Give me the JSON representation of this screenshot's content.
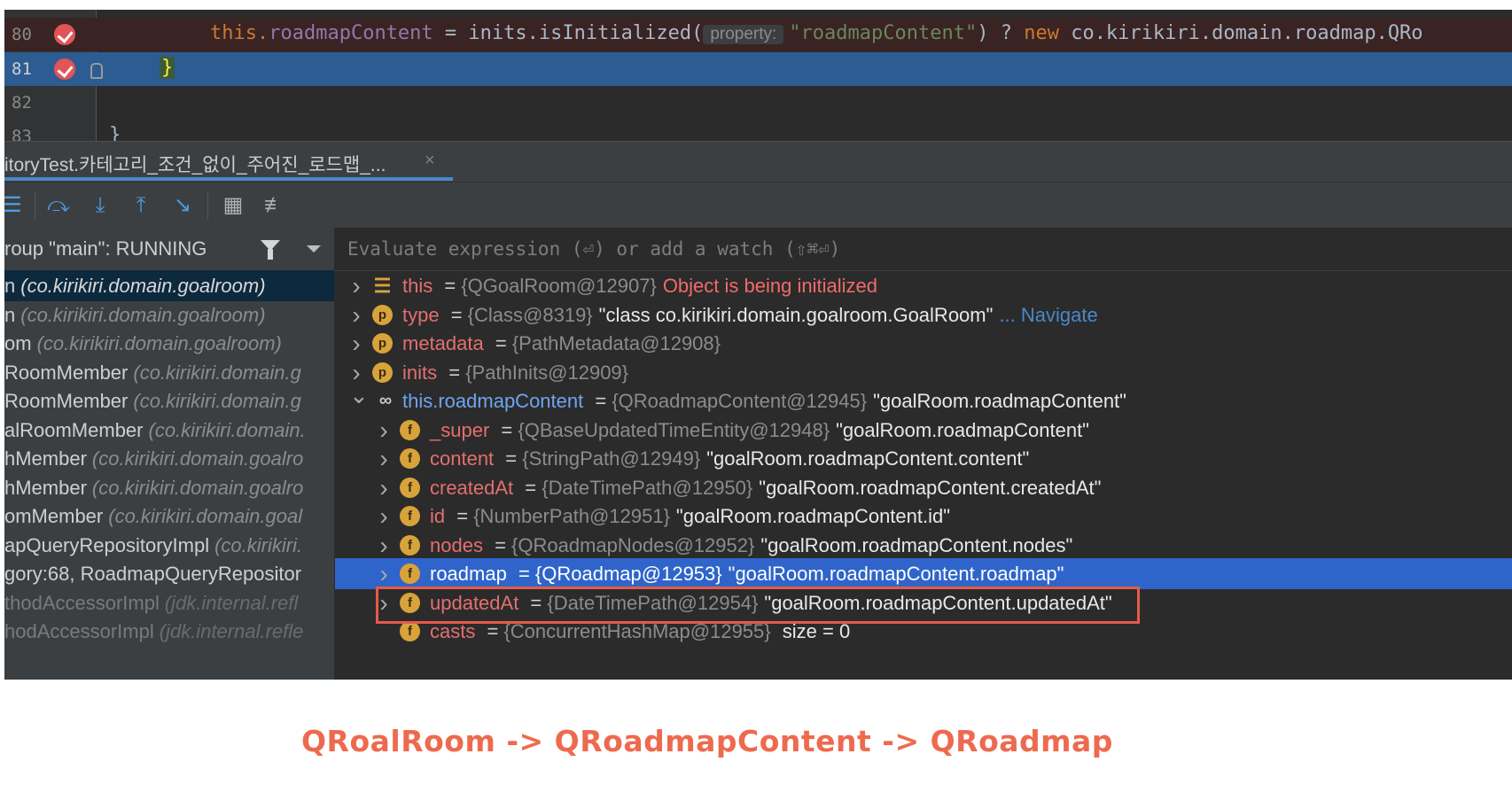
{
  "editor": {
    "lines": [
      {
        "number": "80",
        "code_prefix": "this.",
        "field": "roadmapContent",
        "mid": " = inits.isInitialized(",
        "hint": "property:",
        "string": "\"roadmapContent\"",
        "tail_a": ") ? ",
        "keyword_new": "new",
        "tail_b": " co.kirikiri.domain.roadmap.QRo"
      },
      {
        "number": "81",
        "text": "}"
      },
      {
        "number": "82",
        "text": ""
      },
      {
        "number": "83",
        "text": "}"
      }
    ]
  },
  "tab": {
    "label": "itoryTest.카테고리_조건_없이_주어진_로드맵_...",
    "close": "×"
  },
  "toolbar": {
    "icons": [
      "menu-icon",
      "show-execution-point-icon",
      "step-over-icon",
      "step-into-icon",
      "step-out-icon",
      "run-to-cursor-icon",
      "evaluate-table-icon",
      "trace-icon"
    ]
  },
  "frames": {
    "thread": "roup \"main\": RUNNING",
    "items": [
      {
        "name": "n",
        "pkg": "(co.kirikiri.domain.goalroom)",
        "selected": true,
        "lib": false
      },
      {
        "name": "n",
        "pkg": "(co.kirikiri.domain.goalroom)",
        "selected": false,
        "lib": false
      },
      {
        "name": "om",
        "pkg": "(co.kirikiri.domain.goalroom)",
        "selected": false,
        "lib": false
      },
      {
        "name": "RoomMember",
        "pkg": "(co.kirikiri.domain.g",
        "selected": false,
        "lib": false
      },
      {
        "name": "RoomMember",
        "pkg": "(co.kirikiri.domain.g",
        "selected": false,
        "lib": false
      },
      {
        "name": "alRoomMember",
        "pkg": "(co.kirikiri.domain.",
        "selected": false,
        "lib": false
      },
      {
        "name": "hMember",
        "pkg": "(co.kirikiri.domain.goalro",
        "selected": false,
        "lib": false
      },
      {
        "name": "hMember",
        "pkg": "(co.kirikiri.domain.goalro",
        "selected": false,
        "lib": false
      },
      {
        "name": "omMember",
        "pkg": "(co.kirikiri.domain.goal",
        "selected": false,
        "lib": false
      },
      {
        "name": "apQueryRepositoryImpl",
        "pkg": "(co.kirikiri.",
        "selected": false,
        "lib": false
      },
      {
        "name": "gory:68, RoadmapQueryRepositor",
        "pkg": "",
        "selected": false,
        "lib": false
      },
      {
        "name": "thodAccessorImpl",
        "pkg": "(jdk.internal.refl",
        "selected": false,
        "lib": true
      },
      {
        "name": "hodAccessorImpl",
        "pkg": "(jdk.internal.refle",
        "selected": false,
        "lib": true
      }
    ]
  },
  "evaluate": {
    "placeholder": "Evaluate expression (⏎) or add a watch (⇧⌘⏎)"
  },
  "variables": [
    {
      "level": 0,
      "expand": "right",
      "icon": "list",
      "name": "this",
      "type": "{QGoalRoom@12907}",
      "value": "",
      "error": "Object is being initialized",
      "nav": "",
      "selected": false
    },
    {
      "level": 0,
      "expand": "right",
      "icon": "p",
      "name": "type",
      "type": "{Class@8319}",
      "value": "\"class co.kirikiri.domain.goalroom.GoalRoom\"",
      "error": "",
      "nav": "... Navigate",
      "selected": false
    },
    {
      "level": 0,
      "expand": "right",
      "icon": "p",
      "name": "metadata",
      "type": "{PathMetadata@12908}",
      "value": "",
      "error": "",
      "nav": "",
      "selected": false
    },
    {
      "level": 0,
      "expand": "right",
      "icon": "p",
      "name": "inits",
      "type": "{PathInits@12909}",
      "value": "",
      "error": "",
      "nav": "",
      "selected": false
    },
    {
      "level": 0,
      "expand": "down",
      "icon": "watch",
      "name": "this.roadmapContent",
      "type": "{QRoadmapContent@12945}",
      "value": "\"goalRoom.roadmapContent\"",
      "error": "",
      "nav": "",
      "selected": false
    },
    {
      "level": 1,
      "expand": "right",
      "icon": "f",
      "name": "_super",
      "type": "{QBaseUpdatedTimeEntity@12948}",
      "value": "\"goalRoom.roadmapContent\"",
      "error": "",
      "nav": "",
      "selected": false
    },
    {
      "level": 1,
      "expand": "right",
      "icon": "f",
      "name": "content",
      "type": "{StringPath@12949}",
      "value": "\"goalRoom.roadmapContent.content\"",
      "error": "",
      "nav": "",
      "selected": false
    },
    {
      "level": 1,
      "expand": "right",
      "icon": "f",
      "name": "createdAt",
      "type": "{DateTimePath@12950}",
      "value": "\"goalRoom.roadmapContent.createdAt\"",
      "error": "",
      "nav": "",
      "selected": false
    },
    {
      "level": 1,
      "expand": "right",
      "icon": "f",
      "name": "id",
      "type": "{NumberPath@12951}",
      "value": "\"goalRoom.roadmapContent.id\"",
      "error": "",
      "nav": "",
      "selected": false
    },
    {
      "level": 1,
      "expand": "right",
      "icon": "f",
      "name": "nodes",
      "type": "{QRoadmapNodes@12952}",
      "value": "\"goalRoom.roadmapContent.nodes\"",
      "error": "",
      "nav": "",
      "selected": false
    },
    {
      "level": 1,
      "expand": "right",
      "icon": "f",
      "name": "roadmap",
      "type": "{QRoadmap@12953}",
      "value": "\"goalRoom.roadmapContent.roadmap\"",
      "error": "",
      "nav": "",
      "selected": true
    },
    {
      "level": 1,
      "expand": "right",
      "icon": "f",
      "name": "updatedAt",
      "type": "{DateTimePath@12954}",
      "value": "\"goalRoom.roadmapContent.updatedAt\"",
      "error": "",
      "nav": "",
      "selected": false
    },
    {
      "level": 1,
      "expand": "none",
      "icon": "f",
      "name": "casts",
      "type": "{ConcurrentHashMap@12955}",
      "value": " size = 0",
      "error": "",
      "nav": "",
      "selected": false
    }
  ],
  "caption": "QRoalRoom -> QRoadmapContent -> QRoadmap",
  "colors": {
    "highlight_box": "#e45b48",
    "caption": "#ee6a4f",
    "selection": "#2f65ca"
  }
}
